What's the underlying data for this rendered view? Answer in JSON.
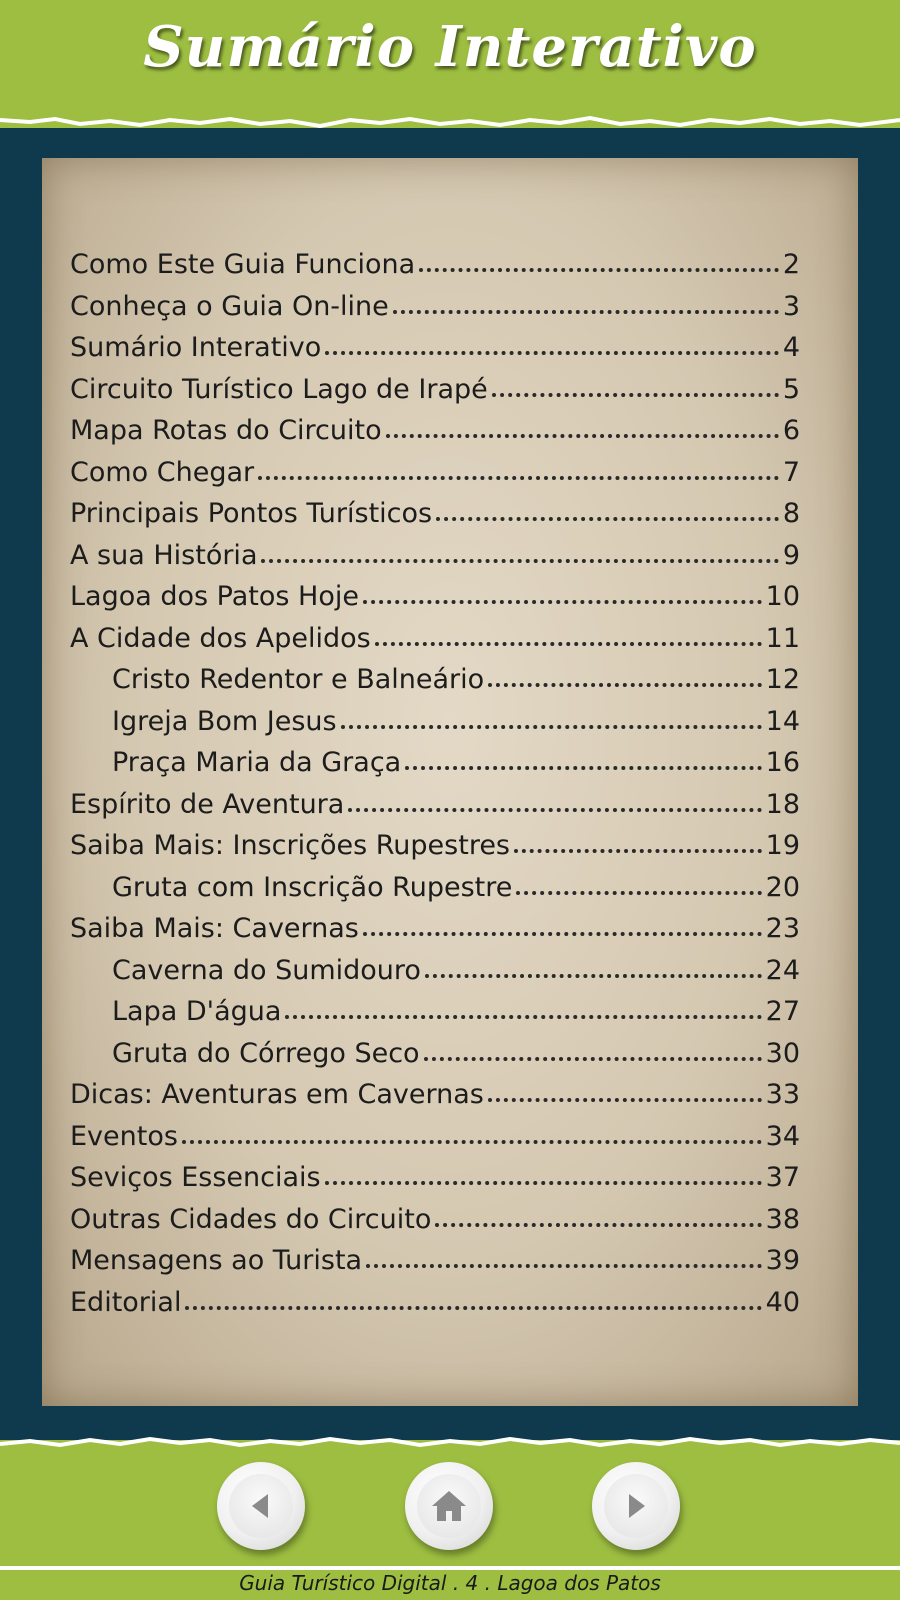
{
  "header": {
    "title": "Sumário Interativo"
  },
  "toc": {
    "items": [
      {
        "title": "Como Este Guia Funciona",
        "page": "2",
        "level": 0
      },
      {
        "title": "Conheça o Guia On-line",
        "page": "3",
        "level": 0
      },
      {
        "title": "Sumário Interativo",
        "page": "4",
        "level": 0
      },
      {
        "title": "Circuito Turístico Lago de Irapé",
        "page": "5",
        "level": 0
      },
      {
        "title": "Mapa Rotas do Circuito",
        "page": "6",
        "level": 0
      },
      {
        "title": "Como Chegar",
        "page": "7",
        "level": 0
      },
      {
        "title": "Principais Pontos Turísticos",
        "page": "8",
        "level": 0
      },
      {
        "title": "A sua História",
        "page": "9",
        "level": 0
      },
      {
        "title": "Lagoa dos Patos Hoje",
        "page": "10",
        "level": 0
      },
      {
        "title": "A Cidade dos Apelidos",
        "page": "11",
        "level": 0
      },
      {
        "title": "Cristo Redentor e Balneário",
        "page": "12",
        "level": 1
      },
      {
        "title": "Igreja Bom Jesus",
        "page": "14",
        "level": 1
      },
      {
        "title": "Praça Maria da Graça",
        "page": "16",
        "level": 1
      },
      {
        "title": "Espírito de Aventura",
        "page": "18",
        "level": 0
      },
      {
        "title": "Saiba Mais: Inscrições Rupestres",
        "page": "19",
        "level": 0
      },
      {
        "title": "Gruta com Inscrição Rupestre",
        "page": "20",
        "level": 1
      },
      {
        "title": "Saiba Mais: Cavernas",
        "page": "23",
        "level": 0
      },
      {
        "title": "Caverna do Sumidouro",
        "page": "24",
        "level": 1
      },
      {
        "title": "Lapa D'água",
        "page": "27",
        "level": 1
      },
      {
        "title": "Gruta do Córrego Seco",
        "page": "30",
        "level": 1
      },
      {
        "title": "Dicas: Aventuras em Cavernas",
        "page": "33",
        "level": 0
      },
      {
        "title": "Eventos",
        "page": "34",
        "level": 0
      },
      {
        "title": "Seviços Essenciais",
        "page": "37",
        "level": 0
      },
      {
        "title": "Outras Cidades do Circuito",
        "page": "38",
        "level": 0
      },
      {
        "title": "Mensagens ao Turista",
        "page": "39",
        "level": 0
      },
      {
        "title": "Editorial",
        "page": "40",
        "level": 0
      }
    ]
  },
  "nav": {
    "prev_icon": "arrow-left-icon",
    "home_icon": "home-icon",
    "next_icon": "arrow-right-icon"
  },
  "footer": {
    "caption": "Guia Turístico Digital . 4 . Lagoa dos Patos"
  },
  "colors": {
    "green": "#9dbe41",
    "navy": "#0f3a4e",
    "paper": "#d5c8b1"
  }
}
